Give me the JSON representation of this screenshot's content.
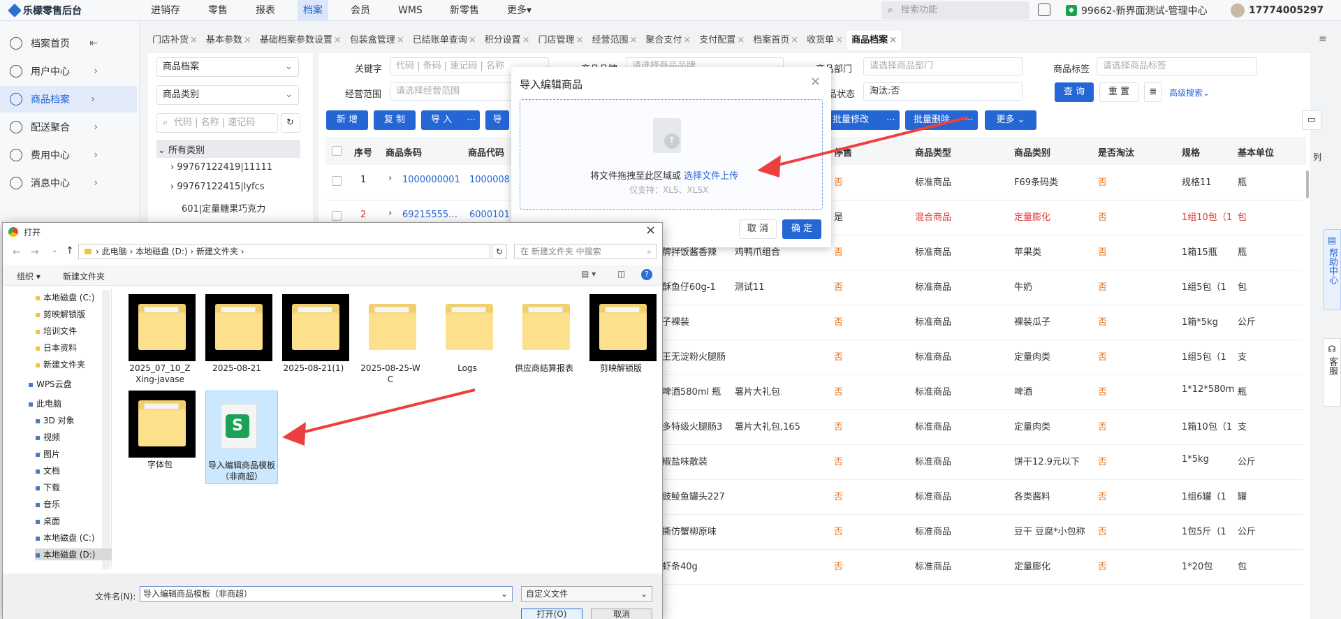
{
  "app": {
    "logo": "乐檬零售后台",
    "search_placeholder": "搜索功能",
    "store": "99662-新界面测试-管理中心",
    "user": "17774005297"
  },
  "topnav": [
    "进销存",
    "零售",
    "报表",
    "档案",
    "会员",
    "WMS",
    "新零售",
    "更多"
  ],
  "sidebar": [
    {
      "label": "档案首页"
    },
    {
      "label": "用户中心"
    },
    {
      "label": "商品档案"
    },
    {
      "label": "配送聚合"
    },
    {
      "label": "费用中心"
    },
    {
      "label": "消息中心"
    }
  ],
  "tabs": [
    "门店补货",
    "基本参数",
    "基础档案参数设置",
    "包装盒管理",
    "已结账单查询",
    "积分设置",
    "门店管理",
    "经营范围",
    "聚合支付",
    "支付配置",
    "档案首页",
    "收货单",
    "商品档案"
  ],
  "left_panel": {
    "archive_select": "商品档案",
    "category_select": "商品类别",
    "search_placeholder": "代码 | 名称 | 速记码",
    "tree": [
      "所有类别",
      "99767122419|11111",
      "99767122415|lyfcs",
      "601|定量糖果巧克力"
    ]
  },
  "filters": {
    "keyword_label": "关键字",
    "keyword_placeholder": "代码 | 条码 | 速记码 | 名称",
    "brand_label": "商品品牌",
    "brand_placeholder": "请选择商品品牌",
    "dept_label": "商品部门",
    "dept_placeholder": "请选择商品部门",
    "tag_label": "商品标签",
    "tag_placeholder": "请选择商品标签",
    "scope_label": "经营范围",
    "scope_placeholder": "请选择经营范围",
    "status_label": "商品状态",
    "status_value": "淘汰:否",
    "query": "查 询",
    "reset": "重 置",
    "advanced": "高级搜索"
  },
  "toolbar": {
    "add": "新 增",
    "copy": "复 制",
    "import": "导 入",
    "export": "导",
    "batch_edit": "批量修改",
    "batch_delete": "批量删除",
    "more": "更多"
  },
  "table": {
    "headers": [
      "序号",
      "商品条码",
      "商品代码",
      "停售",
      "商品类型",
      "商品类别",
      "是否淘汰",
      "规格",
      "基本单位",
      "列"
    ],
    "rows": [
      {
        "no": "1",
        "barcode": "1000000001",
        "code": "1000008",
        "name": "",
        "sub": "",
        "stop": "否",
        "type": "标准商品",
        "cat": "F69条码类",
        "out": "否",
        "spec": "规格11",
        "unit": "瓶"
      },
      {
        "no": "2",
        "barcode": "69215555…",
        "code": "60001010",
        "name": "",
        "sub": "",
        "stop": "是",
        "type": "混合商品",
        "cat": "定量膨化",
        "out": "否",
        "spec": "1组10包（1",
        "unit": "包"
      },
      {
        "no": "",
        "barcode": "",
        "code": "",
        "name": "牌拌饭酱香辣",
        "sub": "鸡鸭爪组合",
        "stop": "否",
        "type": "标准商品",
        "cat": "苹果类",
        "out": "否",
        "spec": "1箱15瓶",
        "unit": "瓶"
      },
      {
        "no": "",
        "barcode": "",
        "code": "",
        "name": "酥鱼仔60g-1",
        "sub": "测试11",
        "stop": "否",
        "type": "标准商品",
        "cat": "牛奶",
        "out": "否",
        "spec": "1组5包（1",
        "unit": "包"
      },
      {
        "no": "",
        "barcode": "",
        "code": "",
        "name": "子裸装",
        "sub": "",
        "stop": "否",
        "type": "标准商品",
        "cat": "裸装瓜子",
        "out": "否",
        "spec": "1箱*5kg",
        "unit": "公斤"
      },
      {
        "no": "",
        "barcode": "",
        "code": "",
        "name": "王无淀粉火腿肠",
        "sub": "",
        "stop": "否",
        "type": "标准商品",
        "cat": "定量肉类",
        "out": "否",
        "spec": "1组5包（1",
        "unit": "支"
      },
      {
        "no": "",
        "barcode": "",
        "code": "",
        "name": "啤酒580ml 瓶",
        "sub": "薯片大礼包",
        "stop": "否",
        "type": "标准商品",
        "cat": "啤酒",
        "out": "否",
        "spec": "1*12*580m",
        "unit": "瓶"
      },
      {
        "no": "",
        "barcode": "",
        "code": "",
        "name": "多特级火腿肠3",
        "sub": "薯片大礼包,165",
        "stop": "否",
        "type": "标准商品",
        "cat": "定量肉类",
        "out": "否",
        "spec": "1箱10包（1",
        "unit": "支"
      },
      {
        "no": "",
        "barcode": "",
        "code": "",
        "name": "椒盐味散装",
        "sub": "",
        "stop": "否",
        "type": "标准商品",
        "cat": "饼干12.9元以下",
        "out": "否",
        "spec": "1*5kg",
        "unit": "公斤"
      },
      {
        "no": "",
        "barcode": "",
        "code": "",
        "name": "豉鲮鱼罐头227",
        "sub": "",
        "stop": "否",
        "type": "标准商品",
        "cat": "各类酱料",
        "out": "否",
        "spec": "1组6罐（1",
        "unit": "罐"
      },
      {
        "no": "",
        "barcode": "",
        "code": "",
        "name": "撕仿蟹柳原味",
        "sub": "",
        "stop": "否",
        "type": "标准商品",
        "cat": "豆干 豆腐*小包称",
        "out": "否",
        "spec": "1包5斤（1",
        "unit": "公斤"
      },
      {
        "no": "",
        "barcode": "",
        "code": "",
        "name": "虾条40g",
        "sub": "",
        "stop": "否",
        "type": "标准商品",
        "cat": "定量膨化",
        "out": "否",
        "spec": "1*20包",
        "unit": "包"
      }
    ]
  },
  "import_dialog": {
    "title": "导入编辑商品",
    "drop_text": "将文件拖拽至此区域或",
    "select_link": "选择文件上传",
    "support": "仅支持：XLS、XLSX",
    "cancel": "取 消",
    "ok": "确 定"
  },
  "file_dialog": {
    "title": "打开",
    "path": [
      "此电脑",
      "本地磁盘 (D:)",
      "新建文件夹"
    ],
    "search_placeholder": "在 新建文件夹 中搜索",
    "organize": "组织",
    "new_folder": "新建文件夹",
    "nav": [
      "本地磁盘 (C:)",
      "剪映解锁版",
      "培训文件",
      "日本资料",
      "新建文件夹",
      "WPS云盘",
      "此电脑",
      "3D 对象",
      "视频",
      "图片",
      "文档",
      "下载",
      "音乐",
      "桌面",
      "本地磁盘 (C:)",
      "本地磁盘 (D:)"
    ],
    "items": [
      "2025_07_10_ZXing-javase",
      "2025-08-21",
      "2025-08-21(1)",
      "2025-08-25-WC",
      "Logs",
      "供应商结算报表",
      "剪映解锁版",
      "字体包",
      "导入编辑商品模板（非商超）"
    ],
    "filename_label": "文件名(N):",
    "filename_value": "导入编辑商品模板（非商超）",
    "filetype": "自定义文件",
    "open": "打开(O)",
    "cancel": "取消"
  },
  "right_float": {
    "help": "帮助中心",
    "service": "客服"
  },
  "colors": {
    "primary": "#2566d5",
    "danger": "#e23c39",
    "warn": "#e87a28",
    "arrow": "#ee3f3f"
  }
}
